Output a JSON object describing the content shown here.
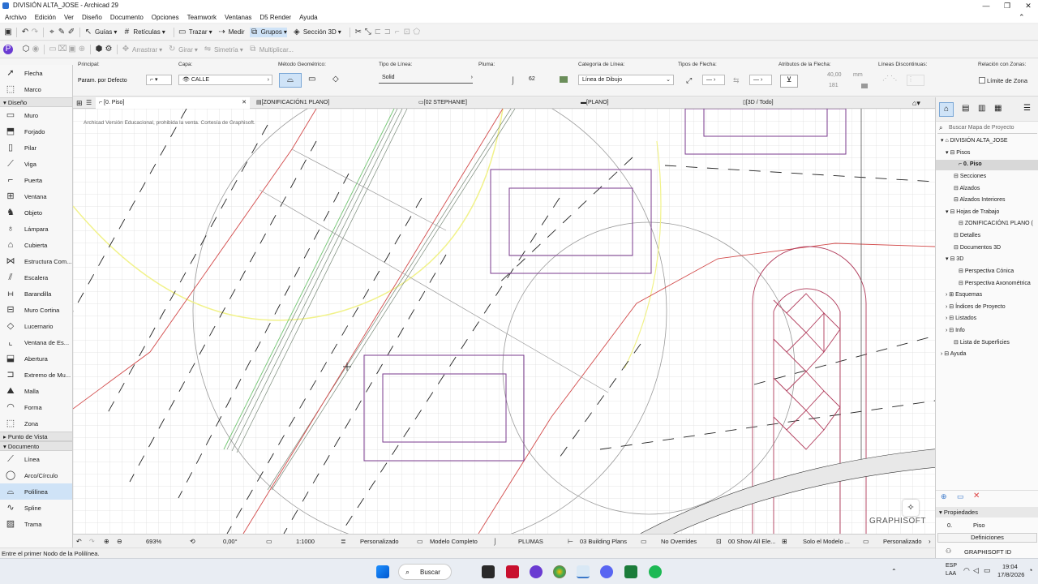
{
  "window": {
    "title": "DIVISIÓN ALTA_JOSE - Archicad 29"
  },
  "menu": [
    "Archivo",
    "Edición",
    "Ver",
    "Diseño",
    "Documento",
    "Opciones",
    "Teamwork",
    "Ventanas",
    "D5 Render",
    "Ayuda"
  ],
  "toolbar1": {
    "guias": "Guías",
    "reticulas": "Retículas",
    "trazar": "Trazar",
    "medir": "Medir",
    "grupos": "Grupos",
    "seccion3d": "Sección 3D"
  },
  "toolbar2": {
    "arrastrar": "Arrastrar",
    "girar": "Girar",
    "simetria": "Simetría",
    "multiplicar": "Multiplicar..."
  },
  "infobox": {
    "principal_label": "Principal:",
    "principal_value": "Param. por Defecto",
    "capa_label": "Capa:",
    "capa_value": "CALLE",
    "metodo_label": "Método Geométrico:",
    "tipo_linea_label": "Tipo de Línea:",
    "tipo_linea_value": "Solid",
    "pluma_label": "Pluma:",
    "pluma_value": "62",
    "categoria_label": "Categoría de Línea:",
    "categoria_value": "Línea de Dibujo",
    "tipos_flecha_label": "Tipos de Flecha:",
    "atributos_flecha_label": "Atributos de la Flecha:",
    "flecha_size": "40,00",
    "flecha_unit": "mm",
    "flecha_pen": "181",
    "lineas_discontinuas_label": "Líneas Discontinuas:",
    "relacion_zonas_label": "Relación con Zonas:",
    "limite_zona": "Límite de Zona"
  },
  "toolbox": {
    "top_tools": [
      {
        "icon": "arrow-icon",
        "label": "Flecha"
      },
      {
        "icon": "marquee-icon",
        "label": "Marco"
      }
    ],
    "diseno_label": "Diseño",
    "diseno_tools": [
      {
        "icon": "wall-icon",
        "label": "Muro"
      },
      {
        "icon": "slab-icon",
        "label": "Forjado"
      },
      {
        "icon": "column-icon",
        "label": "Pilar"
      },
      {
        "icon": "beam-icon",
        "label": "Viga"
      },
      {
        "icon": "door-icon",
        "label": "Puerta"
      },
      {
        "icon": "window-icon",
        "label": "Ventana"
      },
      {
        "icon": "object-icon",
        "label": "Objeto"
      },
      {
        "icon": "lamp-icon",
        "label": "Lámpara"
      },
      {
        "icon": "roof-icon",
        "label": "Cubierta"
      },
      {
        "icon": "structure-icon",
        "label": "Estructura Com..."
      },
      {
        "icon": "stair-icon",
        "label": "Escalera"
      },
      {
        "icon": "railing-icon",
        "label": "Barandilla"
      },
      {
        "icon": "curtain-wall-icon",
        "label": "Muro Cortina"
      },
      {
        "icon": "skylight-icon",
        "label": "Lucernario"
      },
      {
        "icon": "window-corner-icon",
        "label": "Ventana de Es..."
      },
      {
        "icon": "opening-icon",
        "label": "Abertura"
      },
      {
        "icon": "wall-end-icon",
        "label": "Extremo de Mu..."
      },
      {
        "icon": "mesh-icon",
        "label": "Malla"
      },
      {
        "icon": "shell-icon",
        "label": "Forma"
      },
      {
        "icon": "zone-icon",
        "label": "Zona"
      }
    ],
    "punto_vista_label": "Punto de Vista",
    "documento_label": "Documento",
    "documento_tools": [
      {
        "icon": "line-icon",
        "label": "Línea"
      },
      {
        "icon": "arc-icon",
        "label": "Arco/Círculo"
      },
      {
        "icon": "polyline-icon",
        "label": "Polilínea"
      },
      {
        "icon": "spline-icon",
        "label": "Spline"
      },
      {
        "icon": "hatch-icon",
        "label": "Trama"
      }
    ]
  },
  "tabs": [
    "[0. Piso]",
    "[ZONIFICACIÓN1 PLANO]",
    "[02 STEPHANIE]",
    "[PLANO]",
    "[3D / Todo]"
  ],
  "canvas": {
    "watermark": "Archicad Versión Educacional, prohibida la venta. Cortesía de Graphisoft.",
    "brand": "GRAPHISOFT"
  },
  "statusbar": {
    "zoom": "693%",
    "angle": "0,00°",
    "scale": "1:1000",
    "layer_combo": "Personalizado",
    "model": "Modelo Completo",
    "pen_set": "PLUMAS",
    "building_plans": "03 Building Plans",
    "overrides": "No Overrides",
    "show_all": "00 Show All Ele...",
    "solo_modelo": "Solo el Modelo ...",
    "personalizado2": "Personalizado"
  },
  "message": "Entre el primer Nodo de la Polilínea.",
  "navigator": {
    "search_placeholder": "Buscar Mapa de Proyecto",
    "items": [
      {
        "label": "DIVISIÓN ALTA_JOSE",
        "level": 0
      },
      {
        "label": "Pisos",
        "level": 1
      },
      {
        "label": "0. Piso",
        "level": 2,
        "selected": true
      },
      {
        "label": "Secciones",
        "level": 1
      },
      {
        "label": "Alzados",
        "level": 1
      },
      {
        "label": "Alzados Interiores",
        "level": 1
      },
      {
        "label": "Hojas de Trabajo",
        "level": 1
      },
      {
        "label": "ZONIFICACIÓN1 PLANO (",
        "level": 2
      },
      {
        "label": "Detalles",
        "level": 1
      },
      {
        "label": "Documentos 3D",
        "level": 1
      },
      {
        "label": "3D",
        "level": 1
      },
      {
        "label": "Perspectiva Cónica",
        "level": 2
      },
      {
        "label": "Perspectiva Axonométrica",
        "level": 2
      },
      {
        "label": "Esquemas",
        "level": 1
      },
      {
        "label": "Índices de Proyecto",
        "level": 1
      },
      {
        "label": "Listados",
        "level": 1
      },
      {
        "label": "Info",
        "level": 1
      },
      {
        "label": "Lista de Superficies",
        "level": 1
      },
      {
        "label": "Ayuda",
        "level": 0
      }
    ],
    "properties_label": "Propiedades",
    "prop_id": "0.",
    "prop_value": "Piso",
    "definitions": "Definiciones",
    "graphisoft_id": "GRAPHISOFT ID"
  },
  "taskbar": {
    "search": "Buscar",
    "lang1": "ESP",
    "lang2": "LAA",
    "time": "19:04",
    "date": "17/8/2026"
  }
}
